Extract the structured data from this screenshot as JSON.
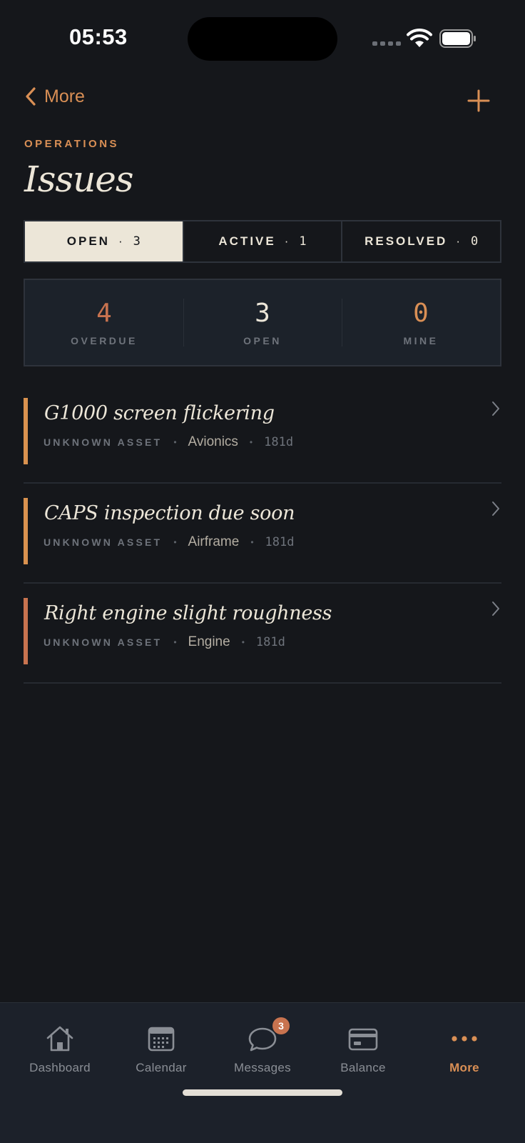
{
  "status_bar": {
    "time": "05:53"
  },
  "nav": {
    "back_label": "More"
  },
  "header": {
    "eyebrow": "OPERATIONS",
    "title": "Issues"
  },
  "tabs": [
    {
      "label": "OPEN",
      "sep": "·",
      "count": "3",
      "active": true
    },
    {
      "label": "ACTIVE",
      "sep": "·",
      "count": "1",
      "active": false
    },
    {
      "label": "RESOLVED",
      "sep": "·",
      "count": "0",
      "active": false
    }
  ],
  "stats": [
    {
      "value": "4",
      "label": "OVERDUE"
    },
    {
      "value": "3",
      "label": "OPEN"
    },
    {
      "value": "0",
      "label": "MINE"
    }
  ],
  "issues": [
    {
      "title": "G1000 screen flickering",
      "asset": "UNKNOWN ASSET",
      "dot": "•",
      "category": "Avionics",
      "age": "181d",
      "priority_color": "#d9924f"
    },
    {
      "title": "CAPS inspection due soon",
      "asset": "UNKNOWN ASSET",
      "dot": "•",
      "category": "Airframe",
      "age": "181d",
      "priority_color": "#d9924f"
    },
    {
      "title": "Right engine slight roughness",
      "asset": "UNKNOWN ASSET",
      "dot": "•",
      "category": "Engine",
      "age": "181d",
      "priority_color": "#c8734f"
    }
  ],
  "tab_bar": {
    "items": [
      {
        "label": "Dashboard",
        "icon": "house-icon",
        "active": false
      },
      {
        "label": "Calendar",
        "icon": "calendar-icon",
        "active": false
      },
      {
        "label": "Messages",
        "icon": "chat-bubble-icon",
        "active": false,
        "badge": "3"
      },
      {
        "label": "Balance",
        "icon": "credit-card-icon",
        "active": false
      },
      {
        "label": "More",
        "icon": "ellipsis-icon",
        "active": true
      }
    ]
  },
  "colors": {
    "accent": "#d98f55",
    "background": "#15171b",
    "card": "#1c222a",
    "text": "#ece6d8",
    "overdue": "#c8734f"
  }
}
